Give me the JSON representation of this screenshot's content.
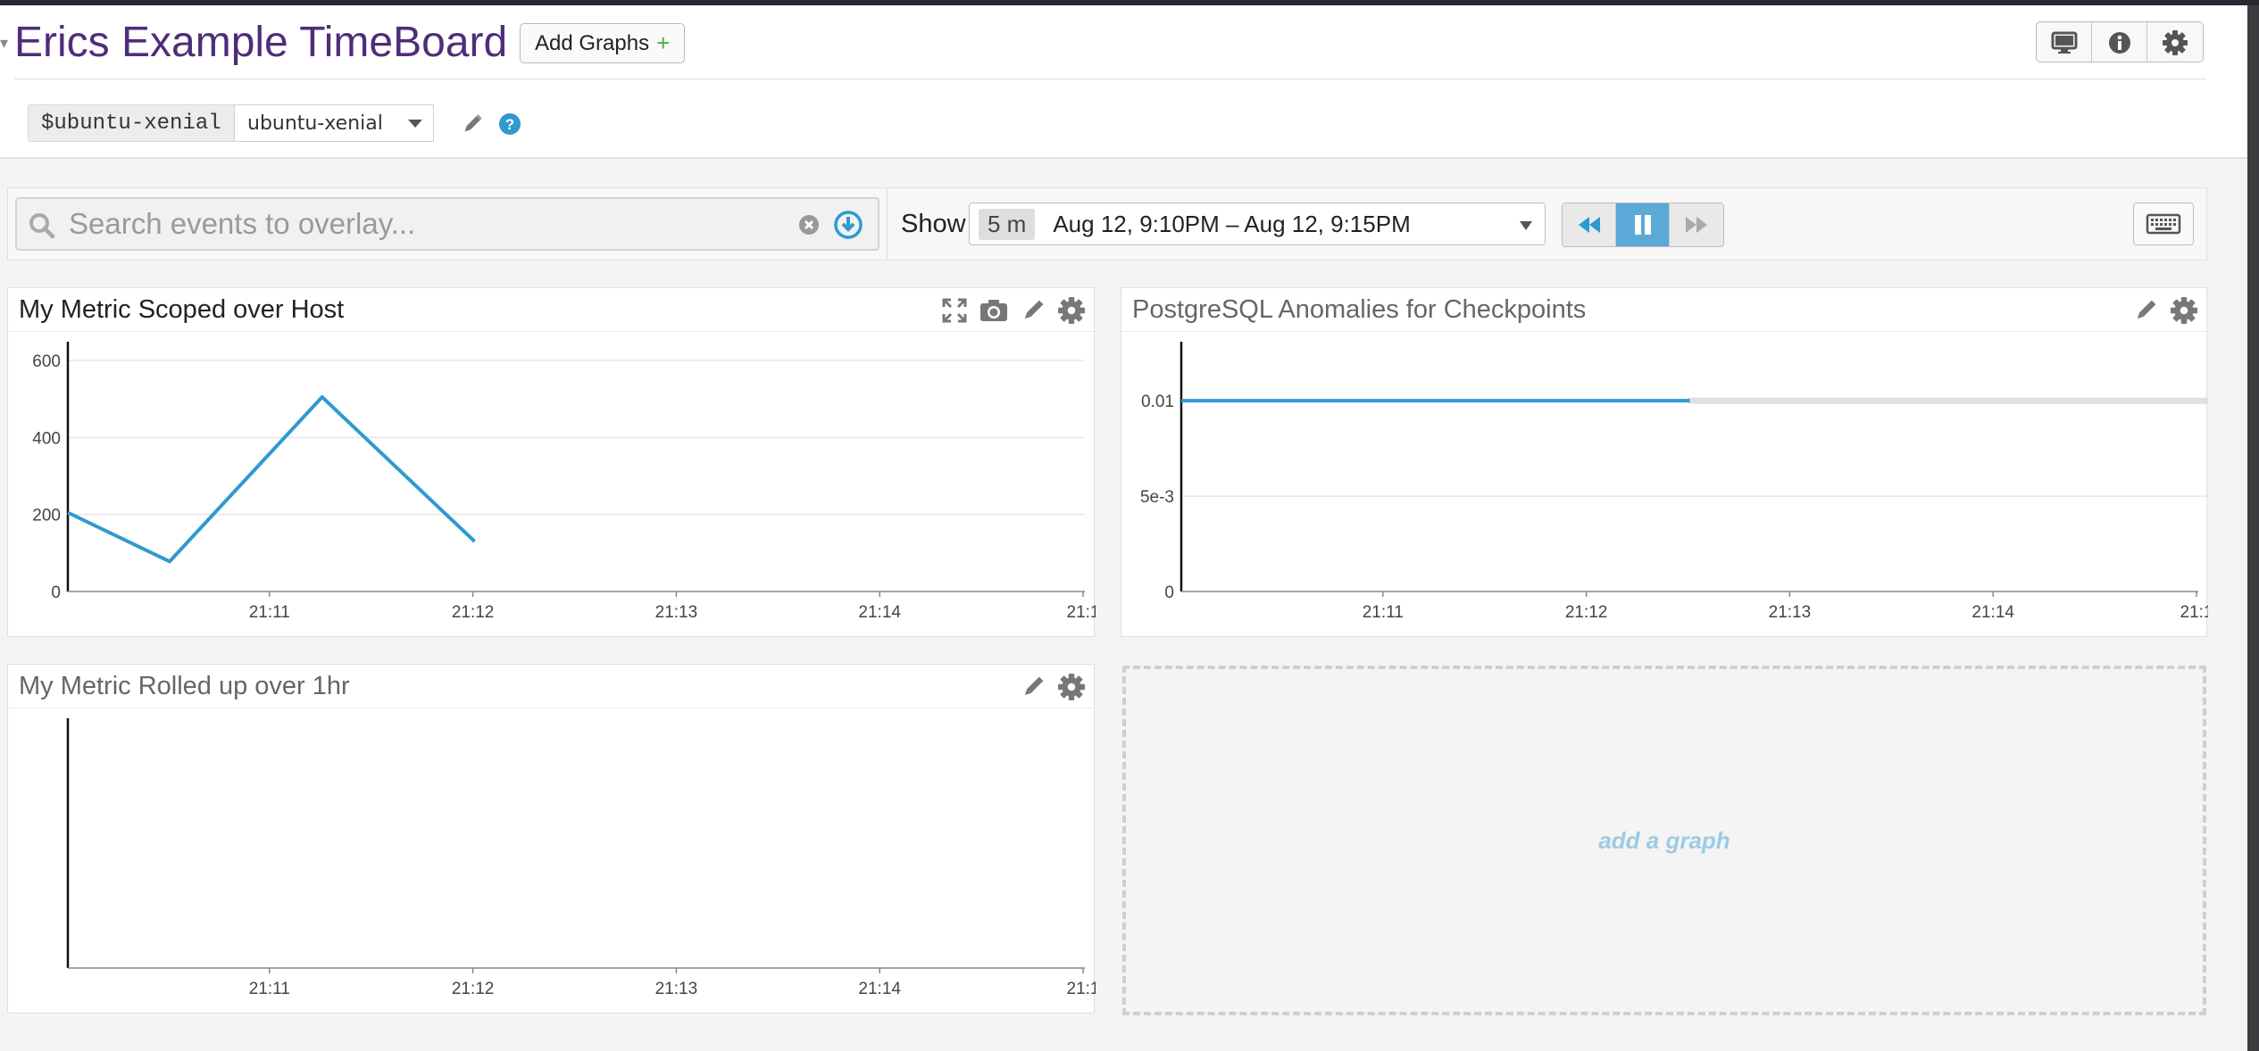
{
  "header": {
    "title": "Erics Example TimeBoard",
    "add_graphs_label": "Add Graphs",
    "add_graphs_plus": "+",
    "buttons": [
      "tv-mode-icon",
      "info-icon",
      "gear-icon"
    ]
  },
  "template_variable": {
    "name": "$ubuntu-xenial",
    "value": "ubuntu-xenial"
  },
  "toolbar": {
    "search_placeholder": "Search events to overlay...",
    "show_label": "Show",
    "time_badge": "5 m",
    "time_range": "Aug 12, 9:10PM – Aug 12, 9:15PM",
    "playback": [
      "rewind-icon",
      "pause-icon",
      "fast-forward-icon"
    ],
    "playback_active": "pause-icon"
  },
  "widgets": [
    {
      "title": "My Metric Scoped over Host",
      "tools": [
        "expand-icon",
        "camera-icon",
        "pencil-icon",
        "gear-icon"
      ]
    },
    {
      "title": "PostgreSQL Anomalies for Checkpoints",
      "tools": [
        "pencil-icon",
        "gear-icon"
      ]
    },
    {
      "title": "My Metric Rolled up over 1hr",
      "tools": [
        "pencil-icon",
        "gear-icon"
      ]
    }
  ],
  "add_graph_label": "add a graph",
  "colors": {
    "accent": "#2f9ad0",
    "title": "#4f2d7a",
    "band": "#e0e0e0",
    "add_graph_text": "#9ccbe4"
  },
  "chart_data": [
    {
      "type": "line",
      "title": "My Metric Scoped over Host",
      "x": [
        "21:10:00",
        "21:10:30",
        "21:11:15",
        "21:12:00"
      ],
      "y": [
        205,
        78,
        505,
        130
      ],
      "xticks": [
        "21:11",
        "21:12",
        "21:13",
        "21:14",
        "21:1"
      ],
      "yticks": [
        "0",
        "200",
        "400",
        "600"
      ],
      "ylim": [
        0,
        600
      ],
      "color": "#2f9ad0"
    },
    {
      "type": "line",
      "title": "PostgreSQL Anomalies for Checkpoints",
      "series": [
        {
          "x": [
            "21:10:00",
            "21:12:30"
          ],
          "y": [
            0.01,
            0.01
          ]
        }
      ],
      "band": {
        "x": [
          "21:12:30",
          "21:15:00"
        ],
        "y": [
          0.01,
          0.01
        ]
      },
      "xticks": [
        "21:11",
        "21:12",
        "21:13",
        "21:14",
        "21:1"
      ],
      "yticks": [
        "0",
        "5e-3",
        "0.01"
      ],
      "ylim": [
        0,
        0.013
      ],
      "color": "#2f9ad0"
    },
    {
      "type": "line",
      "title": "My Metric Rolled up over 1hr",
      "series": [],
      "xticks": [
        "21:11",
        "21:12",
        "21:13",
        "21:14",
        "21:1"
      ],
      "yticks": []
    }
  ]
}
